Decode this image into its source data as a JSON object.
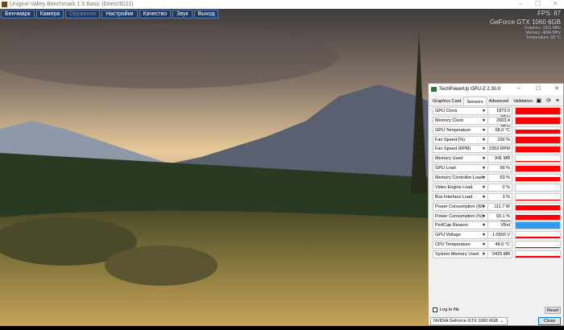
{
  "window": {
    "title": "Unigine Valley Benchmark 1.0 Basic (Direct3D11)",
    "minimize": "–",
    "maximize": "☐",
    "close": "✕"
  },
  "menu": [
    {
      "label": "Бенчмарк",
      "enabled": true
    },
    {
      "label": "Камера",
      "enabled": true
    },
    {
      "label": "Оружение",
      "enabled": false
    },
    {
      "label": "Настройки",
      "enabled": true
    },
    {
      "label": "Качество",
      "enabled": true
    },
    {
      "label": "Звук",
      "enabled": true
    },
    {
      "label": "Выход",
      "enabled": true
    }
  ],
  "overlay": {
    "fps": "FPS: 87",
    "gpu": "GeForce GTX 1060 6GB",
    "graphics": "Graphics: 1911 MHz",
    "memory": "Memory: 4004 MHz",
    "temperature": "Temperature: 68 °C"
  },
  "gpuz": {
    "title": "TechPowerUp GPU-Z 2.30.0",
    "minimize": "–",
    "maximize": "☐",
    "close": "✕",
    "tabs": [
      "Graphics Card",
      "Sensors",
      "Advanced",
      "Validation"
    ],
    "active_tab": "Sensors",
    "tool_icons": "▣ ⟳ ≡",
    "sensors": [
      {
        "name": "GPU Clock",
        "value": "1873.0 MHz",
        "level": 0.95,
        "color": "#ff0000"
      },
      {
        "name": "Memory Clock",
        "value": "2003.4 MHz",
        "level": 0.95,
        "color": "#ff0000"
      },
      {
        "name": "GPU Temperature",
        "value": "68.0 °C",
        "level": 0.6,
        "color": "#ff0000"
      },
      {
        "name": "Fan Speed (%)",
        "value": "100 %",
        "level": 1.0,
        "color": "#ff0000"
      },
      {
        "name": "Fan Speed (RPM)",
        "value": "2353 RPM",
        "level": 0.9,
        "color": "#ff0000"
      },
      {
        "name": "Memory Used",
        "value": "941 MB",
        "level": 0.15,
        "color": "#ff0000"
      },
      {
        "name": "GPU Load",
        "value": "99 %",
        "level": 0.95,
        "color": "#ff0000"
      },
      {
        "name": "Memory Controller Load",
        "value": "63 %",
        "level": 0.6,
        "color": "#ff0000"
      },
      {
        "name": "Video Engine Load",
        "value": "0 %",
        "level": 0,
        "color": "#ff0000"
      },
      {
        "name": "Bus Interface Load",
        "value": "3 %",
        "level": 0.1,
        "color": "#ff0000"
      },
      {
        "name": "Power Consumption (W)",
        "value": "111.7 W",
        "level": 0.7,
        "color": "#ff0000"
      },
      {
        "name": "Power Consumption (%)",
        "value": "93.1 % TDP",
        "level": 0.75,
        "color": "#ff0000"
      },
      {
        "name": "PerfCap Reason",
        "value": "VRel",
        "level": 1.0,
        "color": "#3399ee"
      },
      {
        "name": "GPU Voltage",
        "value": "1.0500 V",
        "level": 0.3,
        "color": "#ff0000"
      },
      {
        "name": "CPU Temperature",
        "value": "48.0 °C",
        "level": 0.2,
        "color": "#ff0000"
      },
      {
        "name": "System Memory Used",
        "value": "2429 MB",
        "level": 0.25,
        "color": "#ff0000"
      }
    ],
    "log_label": "Log to file",
    "reset": "Reset",
    "device": "NVIDIA GeForce GTX 1060 6GB",
    "close_btn": "Close"
  }
}
